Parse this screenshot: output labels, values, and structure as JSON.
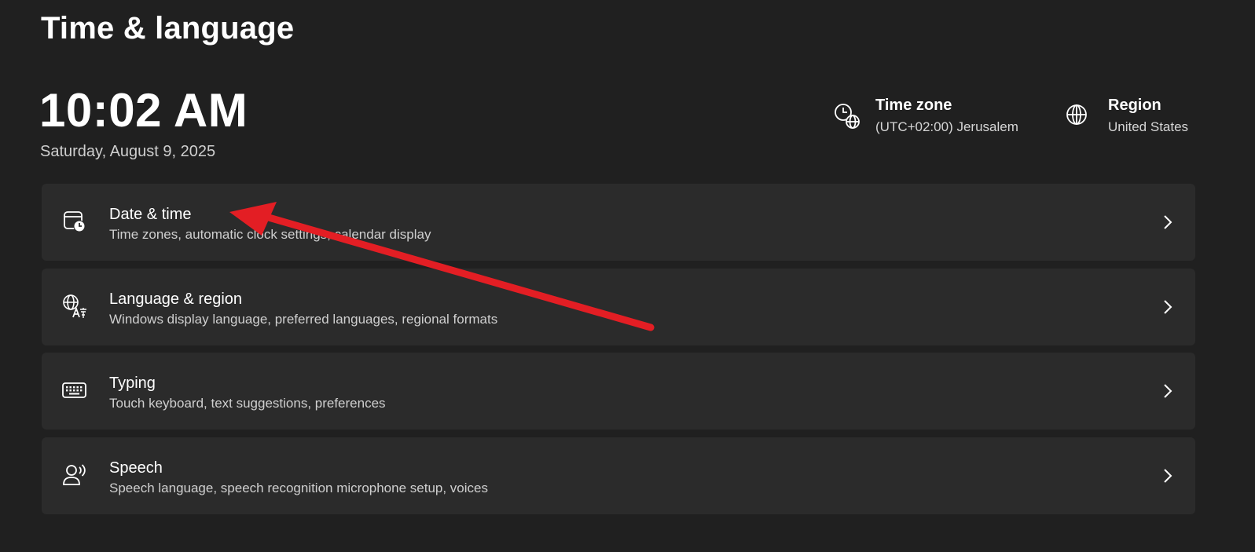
{
  "header": {
    "title": "Time & language"
  },
  "clock": {
    "time": "10:02 AM",
    "date": "Saturday, August 9, 2025"
  },
  "time_zone": {
    "title": "Time zone",
    "value": "(UTC+02:00) Jerusalem",
    "icon": "clock-globe-icon"
  },
  "region": {
    "title": "Region",
    "value": "United States",
    "icon": "globe-icon"
  },
  "cards": [
    {
      "title": "Date & time",
      "subtitle": "Time zones, automatic clock settings, calendar display",
      "icon": "calendar-clock-icon"
    },
    {
      "title": "Language & region",
      "subtitle": "Windows display language, preferred languages, regional formats",
      "icon": "language-icon"
    },
    {
      "title": "Typing",
      "subtitle": "Touch keyboard, text suggestions, preferences",
      "icon": "keyboard-icon"
    },
    {
      "title": "Speech",
      "subtitle": "Speech language, speech recognition microphone setup, voices",
      "icon": "speech-icon"
    }
  ],
  "colors": {
    "background": "#202020",
    "card": "#2b2b2b",
    "annotation_arrow": "#e31e24"
  }
}
